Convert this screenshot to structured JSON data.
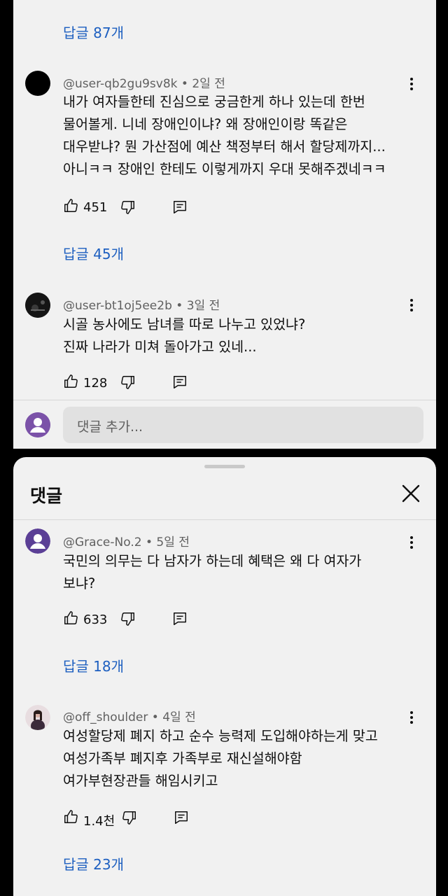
{
  "top_panel": {
    "replies_link_0": "답글 87개",
    "comments": [
      {
        "author": "@user-qb2gu9sv8k",
        "time": "2일 전",
        "lines": [
          "내가 여자들한테 진심으로 궁금한게 하나 있는데 한번",
          "물어볼게. 니네 장애인이냐? 왜 장애인이랑 똑같은",
          "대우받냐? 뭔 가산점에 예산 책정부터 해서 할당제까지...",
          "아니ㅋㅋ 장애인 한테도 이렇게까지 우대 못해주겠네ㅋㅋ"
        ],
        "likes": "451",
        "replies": "답글 45개"
      },
      {
        "author": "@user-bt1oj5ee2b",
        "time": "3일 전",
        "lines": [
          "시골 농사에도 남녀를 따로 나누고 있었냐?",
          "진짜 나라가 미쳐 돌아가고 있네..."
        ],
        "likes": "128"
      }
    ],
    "add_comment_placeholder": "댓글 추가..."
  },
  "sheet": {
    "title": "댓글",
    "comments": [
      {
        "author": "@Grace-No.2",
        "time": "5일 전",
        "lines": [
          "국민의 의무는 다 남자가 하는데 혜택은 왜 다 여자가",
          "보냐?"
        ],
        "likes": "633",
        "replies": "답글 18개"
      },
      {
        "author": "@off_shoulder",
        "time": "4일 전",
        "lines": [
          "여성할당제 폐지 하고 순수 능력제 도입해야하는게 맞고",
          "여성가족부 폐지후 가족부로 재신설해야함",
          "여가부현장관들 해임시키고"
        ],
        "likes": "1.4천",
        "replies": "답글 23개"
      }
    ]
  },
  "colors": {
    "link": "#1d5fc0",
    "panel_bg": "#f1f1f1",
    "default_avatar": "#7b52a8"
  }
}
